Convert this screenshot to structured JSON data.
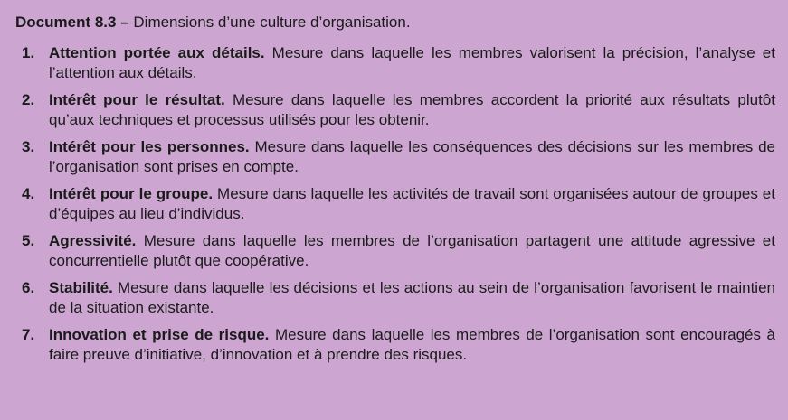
{
  "caption": {
    "label": "Document 8.3 –",
    "text": "Dimensions d’une culture d’organisation."
  },
  "items": [
    {
      "number": "1.",
      "term": "Attention portée aux détails.",
      "description": "Mesure dans laquelle les membres valorisent la précision, l’analyse et l’attention aux détails."
    },
    {
      "number": "2.",
      "term": "Intérêt pour le résultat.",
      "description": "Mesure dans laquelle les membres accordent la priorité aux résultats plutôt qu’aux techniques et processus utilisés pour les obtenir."
    },
    {
      "number": "3.",
      "term": "Intérêt pour les personnes.",
      "description": "Mesure dans laquelle les conséquences des décisions sur les membres de l’organisation sont prises en compte."
    },
    {
      "number": "4.",
      "term": "Intérêt pour le groupe.",
      "description": "Mesure dans laquelle les activités de travail sont organisées autour de groupes et d’équipes au lieu d’individus."
    },
    {
      "number": "5.",
      "term": "Agressivité.",
      "description": "Mesure dans laquelle les membres de l’organisation partagent une attitude agressive et concurrentielle plutôt que coopérative."
    },
    {
      "number": "6.",
      "term": "Stabilité.",
      "description": "Mesure dans laquelle les décisions et les actions au sein de l’organisation favorisent le maintien de la situation existante."
    },
    {
      "number": "7.",
      "term": "Innovation et prise de risque.",
      "description": "Mesure dans laquelle les membres de l’organisation sont encouragés à faire preuve d’initiative, d’innovation et à prendre des risques."
    }
  ],
  "colors": {
    "background": "#cca6d1",
    "text": "#1a1a1a"
  }
}
